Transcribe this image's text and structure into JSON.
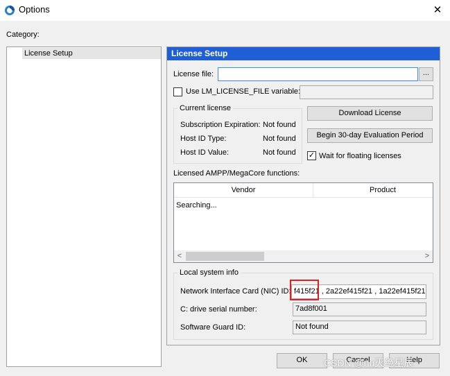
{
  "window": {
    "title": "Options",
    "close_glyph": "✕",
    "icon": "app-logo-icon"
  },
  "category_label": "Category:",
  "tree": {
    "items": [
      {
        "label": "License Setup"
      }
    ]
  },
  "panel": {
    "header": "License Setup",
    "license_file": {
      "label": "License file:",
      "value": "",
      "browse_label": "..."
    },
    "lm_license": {
      "label": "Use LM_LICENSE_FILE variable:",
      "value": "",
      "checked": false
    },
    "current_license": {
      "title": "Current license",
      "rows": [
        {
          "label": "Subscription Expiration:",
          "value": "Not found"
        },
        {
          "label": "Host ID Type:",
          "value": "Not found"
        },
        {
          "label": "Host ID Value:",
          "value": "Not found"
        }
      ]
    },
    "download_button": "Download License",
    "evaluation_button": "Begin 30-day Evaluation Period",
    "wait_floating": {
      "label": "Wait for floating licenses",
      "checked": true,
      "check_glyph": "✓"
    },
    "functions": {
      "label": "Licensed AMPP/MegaCore functions:",
      "columns": [
        "Vendor",
        "Product"
      ],
      "status_text": "Searching...",
      "scroll_left_glyph": "<",
      "scroll_right_glyph": ">"
    },
    "local_info": {
      "title": "Local system info",
      "nic": {
        "label": "Network Interface Card (NIC) ID:",
        "value": "f415f21 , 2a22ef415f21 , 1a22ef415f21"
      },
      "drive": {
        "label": "C: drive serial number:",
        "value": "7ad8f001"
      },
      "guard": {
        "label": "Software Guard ID:",
        "value": "Not found"
      }
    }
  },
  "footer": {
    "ok_label": "OK",
    "cancel_label": "Cancel",
    "help_label": "Help"
  },
  "watermark": "CSDN @nu灭绝星辰",
  "colors": {
    "header_bg": "#1e5ed6",
    "highlight_box": "#e02020"
  }
}
